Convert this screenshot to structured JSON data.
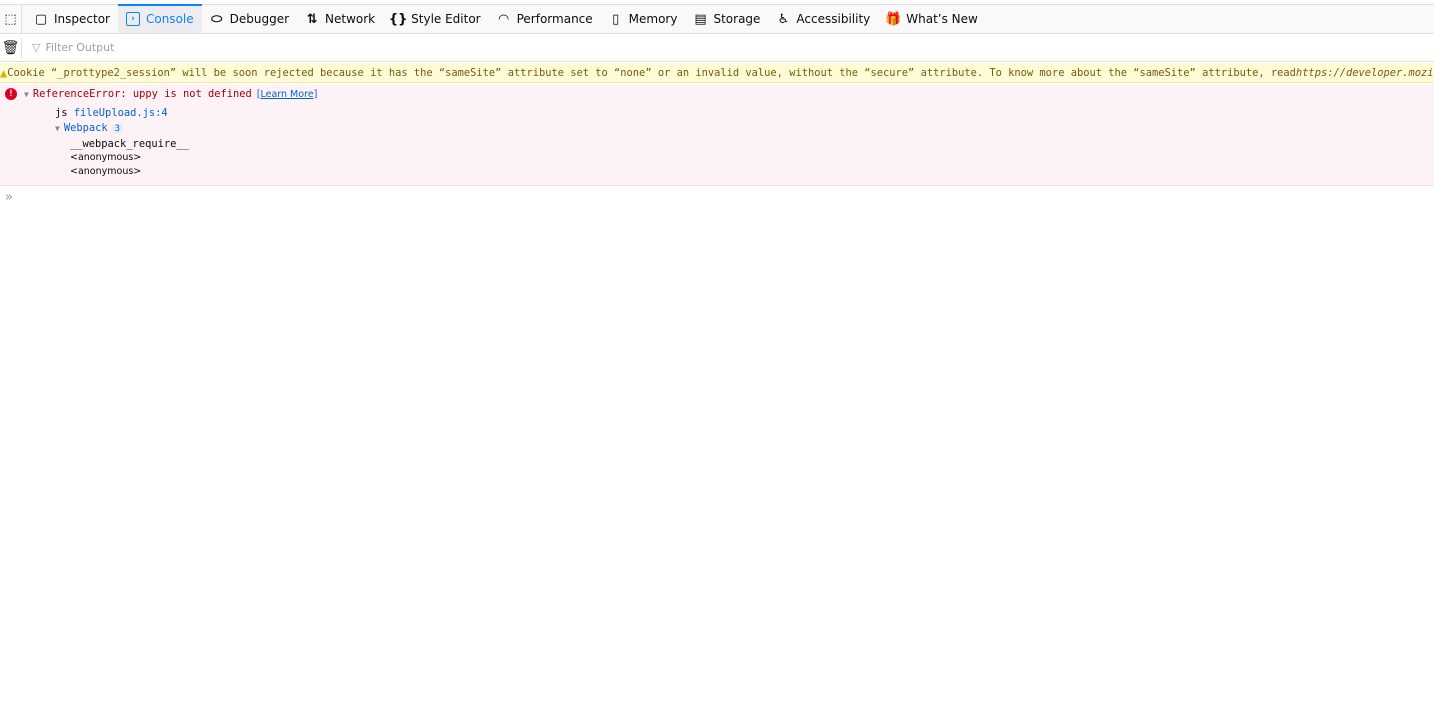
{
  "toolbar": {
    "tabs": [
      {
        "label": "Inspector",
        "icon": "inspector-icon"
      },
      {
        "label": "Console",
        "icon": "console-icon",
        "selected": true
      },
      {
        "label": "Debugger",
        "icon": "debugger-icon"
      },
      {
        "label": "Network",
        "icon": "network-icon"
      },
      {
        "label": "Style Editor",
        "icon": "style-editor-icon"
      },
      {
        "label": "Performance",
        "icon": "performance-icon"
      },
      {
        "label": "Memory",
        "icon": "memory-icon"
      },
      {
        "label": "Storage",
        "icon": "storage-icon"
      },
      {
        "label": "Accessibility",
        "icon": "accessibility-icon"
      },
      {
        "label": "What’s New",
        "icon": "whats-new-icon"
      }
    ]
  },
  "filter": {
    "placeholder": "Filter Output"
  },
  "messages": {
    "warning": {
      "text": "Cookie “_prottype2_session” will be soon rejected because it has the “sameSite” attribute set to “none” or an invalid value, without the “secure” attribute. To know more about the “sameSite” attribute, read ",
      "url": "https://developer.mozilla.org/docs/Web/HTTP/Cookies"
    },
    "error": {
      "text": "ReferenceError: uppy is not defined",
      "learn_more": "[Learn More]",
      "frame_fn": "js",
      "frame_file": "fileUpload.js:4",
      "group": "Webpack",
      "group_count": "3",
      "stack": [
        "__webpack_require__",
        "<anonymous>",
        "<anonymous>"
      ]
    }
  },
  "prompt": "»",
  "colors": {
    "accent": "#0a84ff",
    "warning_bg": "#fffbd6",
    "error_bg": "#fdf2f5",
    "error_text": "#a4000f"
  }
}
